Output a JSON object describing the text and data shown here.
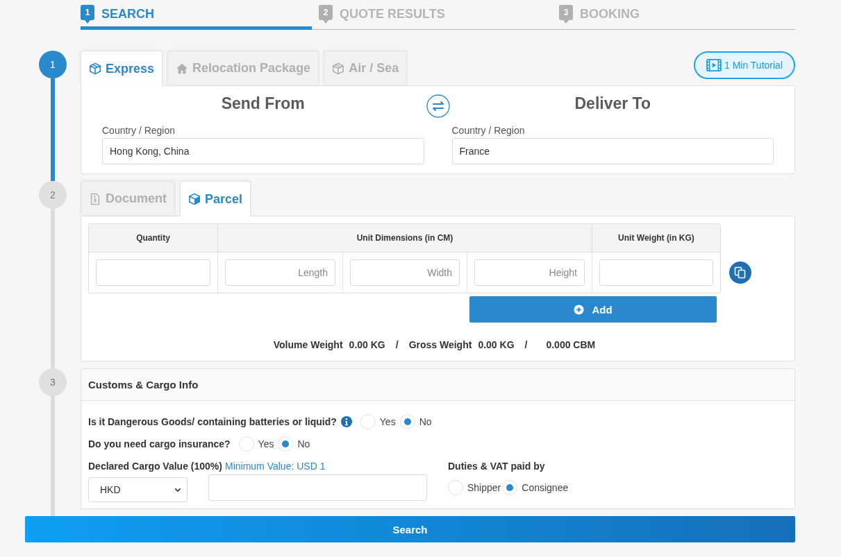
{
  "wizard_steps": [
    {
      "number": "1",
      "label": "SEARCH",
      "selected": true
    },
    {
      "number": "2",
      "label": "QUOTE RESULTS",
      "selected": false
    },
    {
      "number": "3",
      "label": "BOOKING",
      "selected": false
    }
  ],
  "timeline": [
    {
      "number": "1",
      "active": true
    },
    {
      "number": "2",
      "active": false
    },
    {
      "number": "3",
      "active": false
    }
  ],
  "service_tabs": [
    {
      "label": "Express",
      "selected": true
    },
    {
      "label": "Relocation Package",
      "selected": false
    },
    {
      "label": "Air / Sea",
      "selected": false
    }
  ],
  "tutorial_button": "1 Min Tutorial",
  "send_from": {
    "title": "Send From",
    "field_label": "Country / Region",
    "value": "Hong Kong, China"
  },
  "deliver_to": {
    "title": "Deliver To",
    "field_label": "Country / Region",
    "value": "France"
  },
  "cargo_tabs": [
    {
      "label": "Document",
      "selected": false
    },
    {
      "label": "Parcel",
      "selected": true
    }
  ],
  "parcel_table": {
    "columns": [
      "Quantity",
      "Unit Dimensions (in CM)",
      "Unit Weight (in KG)"
    ],
    "placeholders": [
      "Length",
      "Width",
      "Height"
    ]
  },
  "add_button": "Add",
  "totals": [
    {
      "label": "Volume Weight",
      "value": "0.00 KG"
    },
    {
      "label": "Gross Weight",
      "value": "0.00 KG"
    },
    {
      "value": "0.000 CBM"
    }
  ],
  "totals_separator": "/",
  "customs": {
    "title": "Customs & Cargo Info",
    "questions": [
      {
        "text": "Is it Dangerous Goods/ containing batteries or liquid?",
        "info": true,
        "options": [
          {
            "label": "Yes",
            "selected": false
          },
          {
            "label": "No",
            "selected": true
          }
        ]
      },
      {
        "text": "Do you need cargo insurance?",
        "info": false,
        "options": [
          {
            "label": "Yes",
            "selected": false
          },
          {
            "label": "No",
            "selected": true
          }
        ]
      }
    ],
    "declared_value": {
      "label": "Declared Cargo Value (100%)",
      "hint": "Minimum Value: USD 1",
      "currency": "HKD"
    },
    "duties": {
      "label": "Duties & VAT paid by",
      "options": [
        {
          "label": "Shipper",
          "selected": false
        },
        {
          "label": "Consignee",
          "selected": true
        }
      ]
    }
  },
  "search_button": "Search"
}
